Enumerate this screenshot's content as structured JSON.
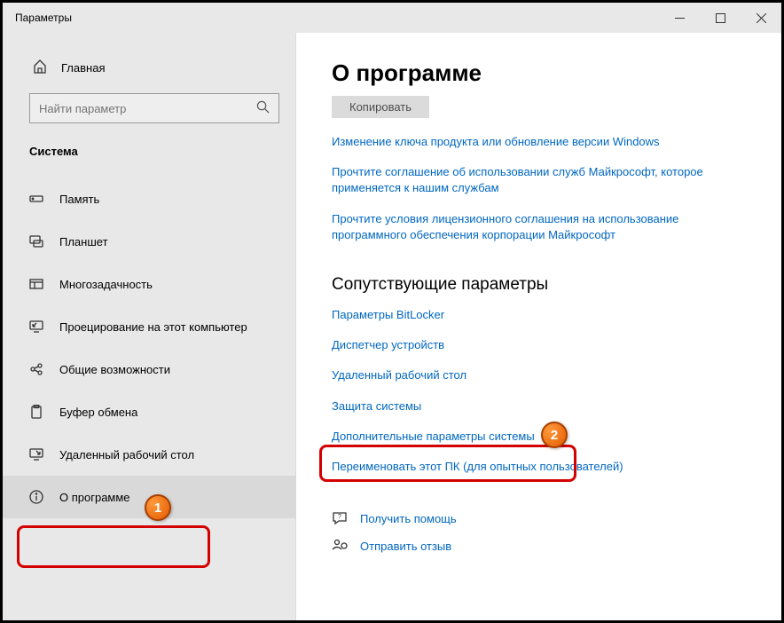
{
  "titlebar": {
    "title": "Параметры"
  },
  "sidebar": {
    "home": "Главная",
    "search_placeholder": "Найти параметр",
    "section": "Система",
    "items": [
      {
        "label": "Память"
      },
      {
        "label": "Планшет"
      },
      {
        "label": "Многозадачность"
      },
      {
        "label": "Проецирование на этот компьютер"
      },
      {
        "label": "Общие возможности"
      },
      {
        "label": "Буфер обмена"
      },
      {
        "label": "Удаленный рабочий стол"
      },
      {
        "label": "О программе"
      }
    ]
  },
  "content": {
    "title": "О программе",
    "copy_label": "Копировать",
    "links_top": [
      "Изменение ключа продукта или обновление версии Windows",
      "Прочтите соглашение об использовании служб Майкрософт, которое применяется к нашим службам",
      "Прочтите условия лицензионного соглашения на использование программного обеспечения корпорации Майкрософт"
    ],
    "related_heading": "Сопутствующие параметры",
    "related_links": [
      "Параметры BitLocker",
      "Диспетчер устройств",
      "Удаленный рабочий стол",
      "Защита системы",
      "Дополнительные параметры системы",
      "Переименовать этот ПК (для опытных пользователей)"
    ],
    "help": "Получить помощь",
    "feedback": "Отправить отзыв"
  },
  "annotations": {
    "badge1": "1",
    "badge2": "2"
  }
}
